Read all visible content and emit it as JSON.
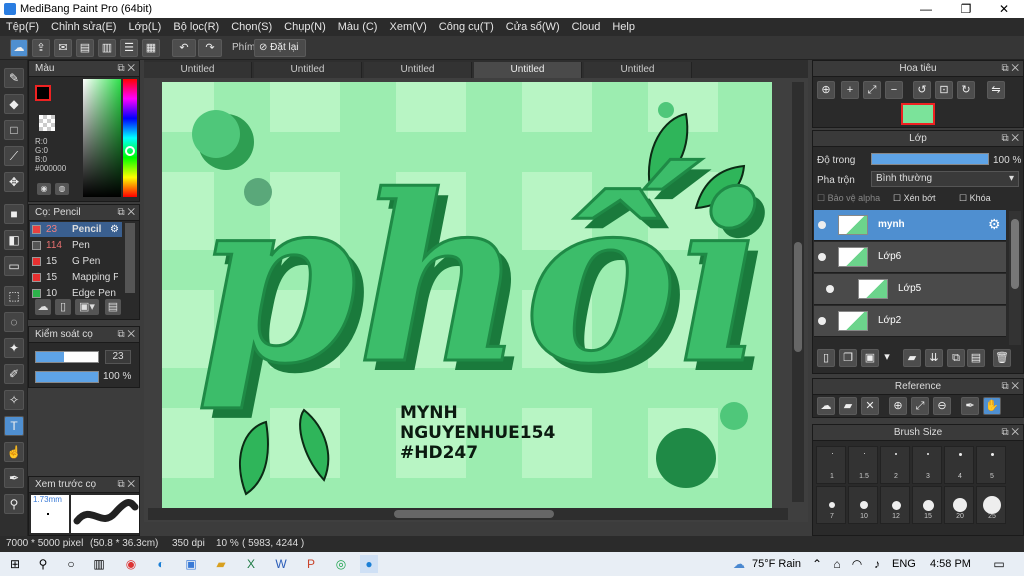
{
  "window": {
    "title": "MediBang Paint Pro (64bit)",
    "controls": [
      "—",
      "❐",
      "✕"
    ]
  },
  "menu": [
    "Tệp(F)",
    "Chỉnh sửa(E)",
    "Lớp(L)",
    "Bộ lọc(R)",
    "Chọn(S)",
    "Chụp(N)",
    "Màu (C)",
    "Xem(V)",
    "Công cụ(T)",
    "Cửa sổ(W)",
    "Cloud",
    "Help"
  ],
  "toolbar": {
    "shortcut_label": "Phím",
    "reset_label": "Đặt lại"
  },
  "tabs": [
    "Untitled",
    "Untitled",
    "Untitled",
    "Untitled",
    "Untitled"
  ],
  "color_panel": {
    "title": "Màu",
    "r": "R:0",
    "g": "G:0",
    "b": "B:0",
    "hex": "#000000",
    "fg": "#000000",
    "bg": "#ffffff"
  },
  "brush_panel": {
    "title": "Cọ: Pencil",
    "items": [
      {
        "size": "23",
        "name": "Pencil",
        "color": "#e84040",
        "selected": true
      },
      {
        "size": "114",
        "name": "Pen",
        "color": "#555555",
        "selected": false
      },
      {
        "size": "15",
        "name": "G Pen",
        "color": "#e83030",
        "selected": false
      },
      {
        "size": "15",
        "name": "Mapping Pe",
        "color": "#e83030",
        "selected": false
      },
      {
        "size": "10",
        "name": "Edge Pen",
        "color": "#2db34a",
        "selected": false
      }
    ]
  },
  "brush_control": {
    "title": "Kiểm soát cọ",
    "size_value": "23",
    "opacity_value": "100 %",
    "size_fraction": 0.45,
    "opacity_fraction": 1.0
  },
  "preview": {
    "title": "Xem trước cọ",
    "size_text": "1.73mm"
  },
  "artwork": {
    "main_word": "phối",
    "credits": [
      "MYNH",
      "NGUYENHUE154",
      "#HD247"
    ]
  },
  "navigator": {
    "title": "Hoa tiêu"
  },
  "layers_panel": {
    "title": "Lớp",
    "opacity_label": "Độ trong",
    "opacity_value": "100 %",
    "blend_label": "Pha trộn",
    "blend_value": "Bình thường",
    "protect_alpha": "Bảo vệ alpha",
    "clipping": "Xén bớt",
    "lock": "Khóa",
    "layers": [
      {
        "name": "mynh",
        "selected": true
      },
      {
        "name": "Lớp6",
        "selected": false
      },
      {
        "name": "Lớp5",
        "selected": false
      },
      {
        "name": "Lớp2",
        "selected": false
      }
    ]
  },
  "reference": {
    "title": "Reference"
  },
  "brush_size": {
    "title": "Brush Size",
    "row1": [
      "1",
      "1.5",
      "2",
      "3",
      "4",
      "5"
    ],
    "row2": [
      "7",
      "10",
      "12",
      "15",
      "20",
      "25"
    ]
  },
  "status": {
    "dimensions": "7000 * 5000 pixel",
    "physical": "(50.8 * 36.3cm)",
    "dpi": "350 dpi",
    "zoom": "10 %",
    "coords": "( 5983, 4244 )"
  },
  "taskbar": {
    "weather": "75°F Rain",
    "lang": "ENG",
    "time": "4:58 PM"
  }
}
